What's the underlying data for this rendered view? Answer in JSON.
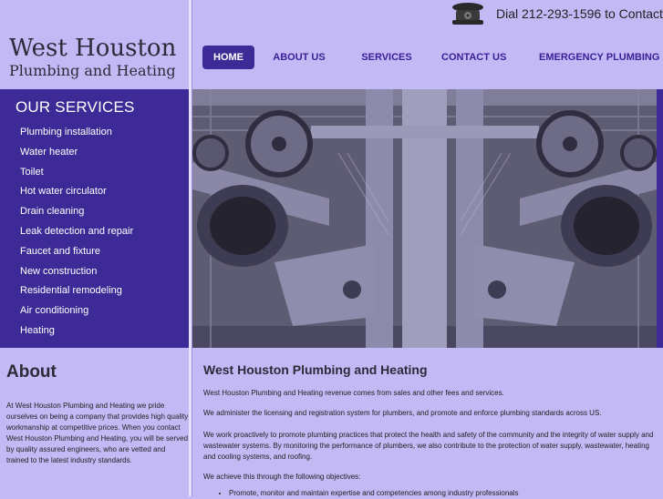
{
  "site": {
    "logo_line1": "West Houston",
    "logo_line2": "Plumbing and Heating"
  },
  "header": {
    "phone_text": "Dial 212-293-1596 to Contact",
    "phone_icon": "telephone-icon"
  },
  "nav": {
    "items": [
      {
        "label": "HOME",
        "active": true
      },
      {
        "label": "ABOUT US",
        "active": false
      },
      {
        "label": "SERVICES",
        "active": false
      },
      {
        "label": "CONTACT US",
        "active": false
      },
      {
        "label": "EMERGENCY PLUMBING",
        "active": false
      }
    ]
  },
  "sidebar": {
    "title": "OUR SERVICES",
    "items": [
      "Plumbing installation",
      "Water heater",
      "Toilet",
      "Hot water circulator",
      "Drain cleaning",
      "Leak detection and repair",
      "Faucet and fixture",
      "New construction",
      "Residential remodeling",
      "Air conditioning",
      "Heating"
    ]
  },
  "about": {
    "title": "About",
    "text": "At West Houston Plumbing and Heating we pride ourselves on being a company that provides high quality workmanship at competitive prices. When you contact West Houston Plumbing and Heating, you will be served by quality assured engineers, who are vetted and trained to the latest industry standards."
  },
  "main": {
    "heading": "West Houston Plumbing and Heating",
    "p1": "West Houston Plumbing and Heating revenue comes from sales and other fees and services.",
    "p2": "We administer the licensing and registration system for plumbers, and promote and enforce plumbing standards across US.",
    "p3": "We work proactively to promote plumbing practices that protect the health and safety of the community and the integrity of water supply and wastewater systems. By monitoring the performance of plumbers, we also contribute to the protection of water supply, wastewater, heating and cooling systems, and roofing.",
    "p4": "We achieve this through the following objectives:",
    "bullet1": "Promote, monitor and maintain expertise and competencies among industry professionals"
  },
  "colors": {
    "background": "#c3b9f5",
    "accent": "#3d2a96",
    "nav_text": "#3a1f96"
  }
}
